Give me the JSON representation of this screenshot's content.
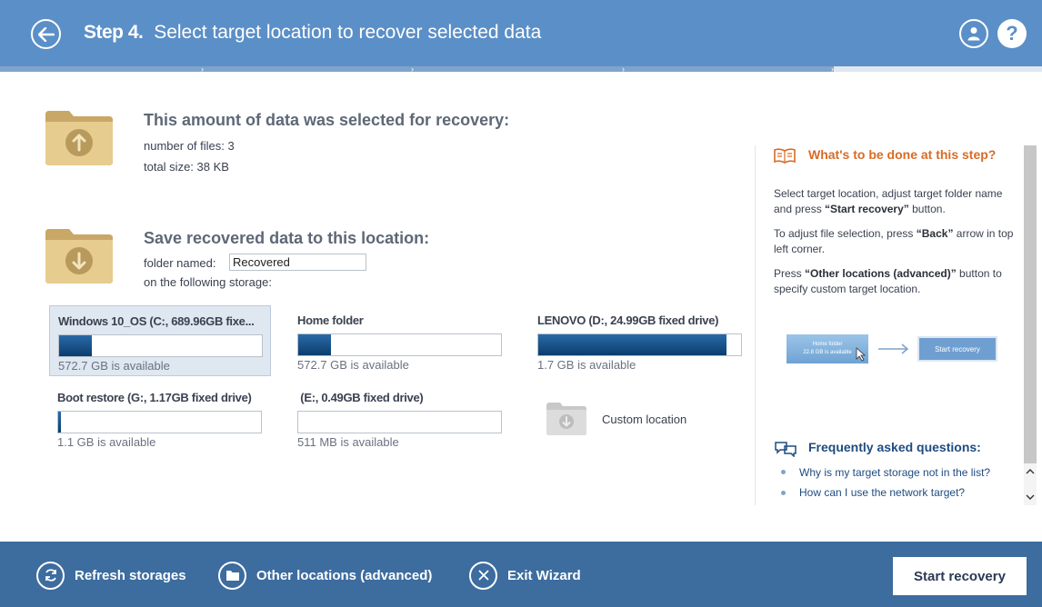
{
  "header": {
    "step_label": "Step 4.",
    "title": "Select target location to recover selected data",
    "progress_pct": 80
  },
  "selection": {
    "heading": "This amount of data was selected for recovery:",
    "files_line": "number of files: 3",
    "size_line": "total size: 38 KB"
  },
  "save": {
    "heading": "Save recovered data to this location:",
    "folder_label": "folder named:",
    "folder_value": "Recovered",
    "storage_label": "on the following storage:"
  },
  "storages": [
    {
      "name": "Windows 10_OS (C:, 689.96GB fixe...",
      "available": "572.7 GB is available",
      "used_fraction": 0.16
    },
    {
      "name": "Home folder",
      "available": "572.7 GB is available",
      "used_fraction": 0.16
    },
    {
      "name": "LENOVO (D:, 24.99GB fixed drive)",
      "available": "1.7 GB is available",
      "used_fraction": 0.93
    },
    {
      "name": "Boot restore (G:, 1.17GB fixed drive)",
      "available": "1.1 GB is available",
      "used_fraction": 0.01
    },
    {
      "name": " (E:, 0.49GB fixed drive)",
      "available": "511 MB is available",
      "used_fraction": 0.0
    }
  ],
  "custom_location": "Custom location",
  "side": {
    "title": "What's to be done at this step?",
    "p1_a": "Select target location, adjust target folder name and press ",
    "p1_b": "“Start recovery”",
    "p1_c": " button.",
    "p2_a": "To adjust file selection, press ",
    "p2_b": "“Back”",
    "p2_c": " arrow in top left corner.",
    "p3_a": "Press ",
    "p3_b": "“Other locations (advanced)”",
    "p3_c": " button to specify custom target location.",
    "illus_card_title": "Home folder",
    "illus_card_sub": "22.8 GB is available",
    "illus_button": "Start recovery",
    "faq_title": "Frequently asked questions:",
    "faq": [
      "Why is my target storage not in the list?",
      "How can I use the network target?"
    ]
  },
  "footer": {
    "refresh": "Refresh storages",
    "other": "Other locations (advanced)",
    "exit": "Exit Wizard",
    "start": "Start recovery"
  },
  "colors": {
    "header": "#5b8fc7",
    "footer": "#3d6c9e",
    "accent_orange": "#d96b24",
    "link_blue": "#1f4b80",
    "bar_fill": "#0b3d6e"
  }
}
